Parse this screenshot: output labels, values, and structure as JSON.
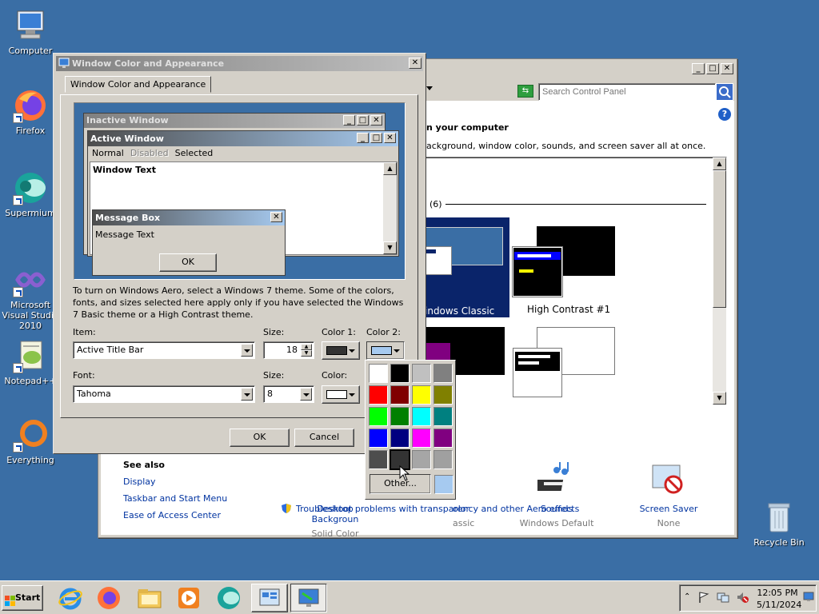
{
  "desktop": {
    "icons": [
      {
        "label": "Computer"
      },
      {
        "label": "Firefox"
      },
      {
        "label": "Supermium"
      },
      {
        "label": "Microsoft Visual Studio 2010"
      },
      {
        "label": "Notepad++"
      },
      {
        "label": "Everything"
      },
      {
        "label": "Recycle Bin"
      }
    ]
  },
  "control_panel": {
    "search_placeholder": "Search Control Panel",
    "heading": "n your computer",
    "subheading": "ackground, window color, sounds, and screen saver all at once.",
    "group_count": "(6)",
    "themes": [
      {
        "label": "indows Classic"
      },
      {
        "label": "High Contrast #1"
      }
    ],
    "bottom_items": [
      {
        "title": "Desktop Backgroun",
        "sub": "Solid Color"
      },
      {
        "title": "olor",
        "sub": "assic"
      },
      {
        "title": "Sounds",
        "sub": "Windows Default"
      },
      {
        "title": "Screen Saver",
        "sub": "None"
      }
    ],
    "see_also": {
      "title": "See also",
      "links": [
        "Display",
        "Taskbar and Start Menu",
        "Ease of Access Center"
      ]
    },
    "troubleshoot_link": "Troubleshoot problems with transparency and other Aero effects"
  },
  "dialog": {
    "title": "Window Color and Appearance",
    "tab": "Window Color and Appearance",
    "preview": {
      "inactive_title": "Inactive Window",
      "active_title": "Active Window",
      "menu_normal": "Normal",
      "menu_disabled": "Disabled",
      "menu_selected": "Selected",
      "window_text": "Window Text",
      "msgbox_title": "Message Box",
      "msgbox_text": "Message Text",
      "msgbox_ok": "OK"
    },
    "info_text": "To turn on Windows Aero, select a Windows 7 theme.  Some of the colors, fonts, and sizes selected here apply only if you have selected the Windows 7 Basic theme or a High Contrast theme.",
    "item_label": "Item:",
    "item_value": "Active Title Bar",
    "size_label": "Size:",
    "size_value": "18",
    "color1_label": "Color 1:",
    "color2_label": "Color 2:",
    "font_label": "Font:",
    "font_value": "Tahoma",
    "font_size_label": "Size:",
    "font_size_value": "8",
    "font_color_label": "Color:",
    "ok": "OK",
    "cancel": "Cancel"
  },
  "palette": {
    "colors": [
      "#ffffff",
      "#000000",
      "#c0c0c0",
      "#808080",
      "#ff0000",
      "#800000",
      "#ffff00",
      "#808000",
      "#00ff00",
      "#008000",
      "#00ffff",
      "#008080",
      "#0000ff",
      "#000080",
      "#ff00ff",
      "#800080",
      "#4d4d4d",
      "#333333",
      "#a6a6a6",
      "#a0a0a0"
    ],
    "other_label": "Other...",
    "custom_color": "#a6caf0"
  },
  "taskbar": {
    "start": "Start",
    "time": "12:05 PM",
    "date": "5/11/2024"
  }
}
